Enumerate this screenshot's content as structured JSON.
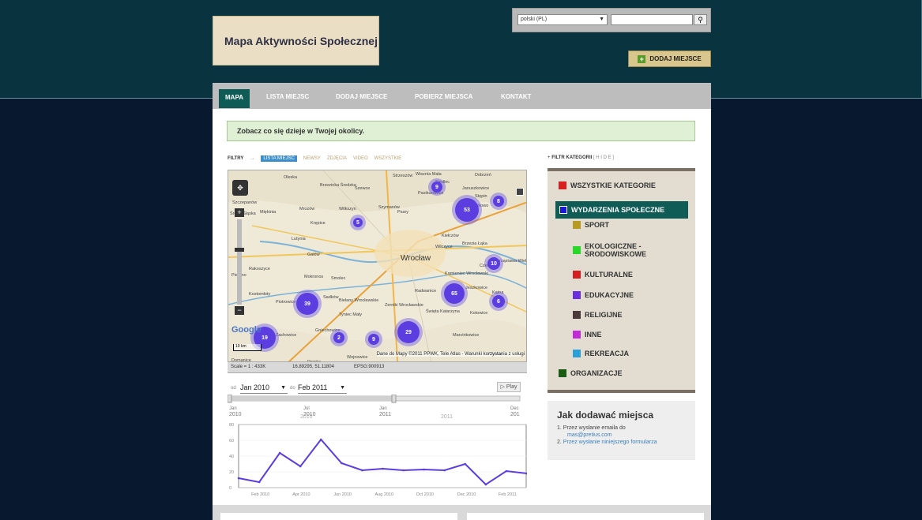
{
  "site": {
    "title": "Mapa Aktywności Społecznej",
    "add_place_button": "DODAJ MIEJSCE"
  },
  "header": {
    "language_select": "polski (PL)",
    "search_placeholder": ""
  },
  "nav": {
    "tabs": [
      {
        "label": "MAPA",
        "active": true
      },
      {
        "label": "LISTA MIEJSC",
        "active": false
      },
      {
        "label": "DODAJ MIEJSCE",
        "active": false
      },
      {
        "label": "POBIERZ MIEJSCA",
        "active": false
      },
      {
        "label": "KONTAKT",
        "active": false
      }
    ]
  },
  "notice": "Zobacz co się dzieje w Twojej okolicy.",
  "filters": {
    "label": "FILTRY",
    "items": [
      "LISTA MIEJSC",
      "NEWSY",
      "ZDJĘCIA",
      "VIDEO",
      "WSZYSTKIE"
    ]
  },
  "map": {
    "places": [
      "Oleska",
      "Brzezinka Średzka",
      "Szewce",
      "Strzeszów",
      "Wisznia Mała",
      "Siedlec",
      "Dobrzeń",
      "Januszkowice",
      "Stępin",
      "Szczepanów",
      "Środa Śląska",
      "Miękinia",
      "Mrozów",
      "Wilkszyn",
      "Szymanów",
      "Psary",
      "Pasikurowice",
      "Bykowo",
      "Kiełczów",
      "Krępice",
      "Lutynia",
      "Wilczyce",
      "Brzezia Łąka",
      "Gałów",
      "Wrocław",
      "Czernica",
      "Kątna",
      "Rakoszyce",
      "Chrząstawa Wielka",
      "Pierzno",
      "Mokronos",
      "Smolec",
      "Kamieniec Wrocławski",
      "Jeszkowice",
      "Kostomłoty",
      "Sadków",
      "Piotrowice",
      "Bielany Wrocławskie",
      "Radwanice",
      "Tyniec Mały",
      "Zerniki Wrocławskie",
      "Święta Katarzyna",
      "Zachowice",
      "Gniechowice",
      "Kotowice",
      "Marcinkowice",
      "Domanice",
      "Rogów",
      "Wojnowice",
      "Oława"
    ],
    "clusters": [
      {
        "count": "53"
      },
      {
        "count": "9"
      },
      {
        "count": "8"
      },
      {
        "count": "5"
      },
      {
        "count": "10"
      },
      {
        "count": "65"
      },
      {
        "count": "6"
      },
      {
        "count": "39"
      },
      {
        "count": "19"
      },
      {
        "count": "2"
      },
      {
        "count": "9"
      },
      {
        "count": "29"
      }
    ],
    "attribution": "Dane do Mapy ©2011 PPWK, Tele Atlas - Warunki korzystania z usługi",
    "scale_label": "Scale = 1 : 433K",
    "coords": "16.89295, 51.11804",
    "epsg": "EPSG:900913",
    "scale_bar": "10 km"
  },
  "timeline": {
    "from_label": "od",
    "from_value": "Jan 2010",
    "to_label": "do",
    "to_value": "Feb 2011",
    "play_label": "Play",
    "top_ticks": [
      "Jan 2010",
      "Jul 2010",
      "Jan 2011",
      "Dec 201"
    ],
    "center_labels": [
      "2010",
      "2011"
    ]
  },
  "chart_data": {
    "type": "line",
    "x": [
      "Jan 2010",
      "Feb 2010",
      "Mar 2010",
      "Apr 2010",
      "May 2010",
      "Jun 2010",
      "Jul 2010",
      "Aug 2010",
      "Sep 2010",
      "Oct 2010",
      "Nov 2010",
      "Dec 2010",
      "Jan 2011",
      "Feb 2011",
      "Mar 2011"
    ],
    "tick_labels": [
      "Feb 2010",
      "Apr 2010",
      "Jun 2010",
      "Aug 2010",
      "Oct 2010",
      "Dec 2010",
      "Feb 2011"
    ],
    "y_ticks": [
      "0",
      "20",
      "40",
      "60",
      "80"
    ],
    "ylim": [
      0,
      80
    ],
    "series": [
      {
        "values": [
          12,
          7,
          44,
          27,
          61,
          31,
          22,
          24,
          22,
          23,
          22,
          30,
          4,
          21,
          18
        ],
        "color": "#5b3de0"
      }
    ]
  },
  "sidebar": {
    "filter_label": "FILTR KATEGORII",
    "hide_label": "[ H I D E ]",
    "categories": [
      {
        "label": "WSZYSTKIE KATEGORIE",
        "color": "#d81e1e"
      },
      {
        "label": "WYDARZENIA SPOŁECZNE",
        "color": "#1a18d8"
      },
      {
        "label": "SPORT",
        "color": "#b89a20"
      },
      {
        "label": "EKOLOGICZNE - ŚRODOWISKOWE",
        "color": "#28d828"
      },
      {
        "label": "KULTURALNE",
        "color": "#d81e1e"
      },
      {
        "label": "EDUKACYJNE",
        "color": "#6a2ee0"
      },
      {
        "label": "RELIGIJNE",
        "color": "#4a3a3a"
      },
      {
        "label": "INNE",
        "color": "#c42bd8"
      },
      {
        "label": "REKREACJA",
        "color": "#2aa0d8"
      },
      {
        "label": "ORGANIZACJE",
        "color": "#1a5c14"
      }
    ]
  },
  "howto": {
    "title": "Jak dodawać miejsca",
    "step1": "Przez wysłanie emaila do",
    "email": "mas@pretius.com",
    "step2": "Przez wysłanie niniejszego formularza"
  }
}
